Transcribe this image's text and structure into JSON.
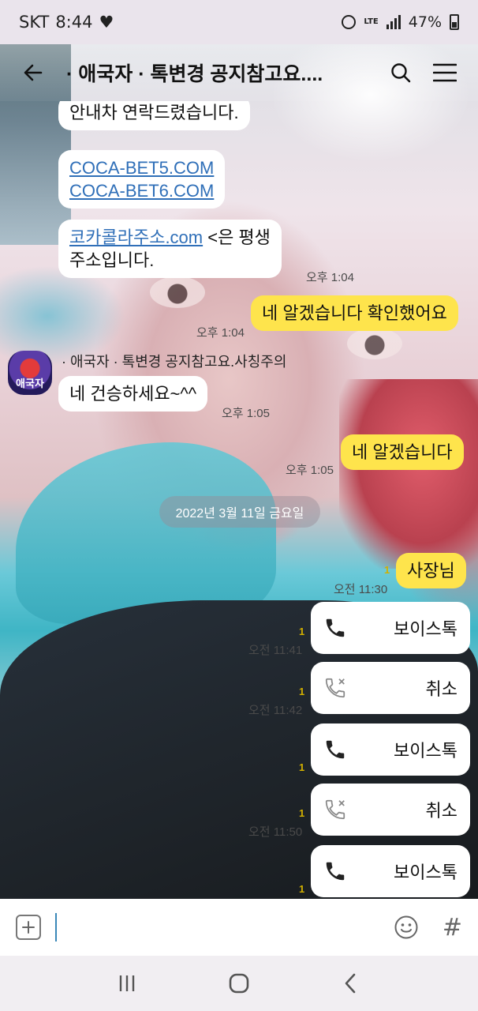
{
  "status_bar": {
    "carrier": "SKT",
    "time": "8:44",
    "heart": "♥",
    "lte": "LTE",
    "battery": "47%"
  },
  "header": {
    "title": "· 애국자 ·  톡변경 공지참고요...."
  },
  "messages": {
    "m1": "안내차 연락드렸습니다.",
    "m2_link1": "COCA-BET5.COM",
    "m2_link2": "COCA-BET6.COM",
    "m3_link": "코카콜라주소.com",
    "m3_rest": " <은 평생",
    "m3_line2": "주소입니다.",
    "t1": "오후 1:04",
    "m4": "네 알겠습니다 확인했어요",
    "t2": "오후 1:04",
    "sender": "· 애국자 ·  톡변경 공지참고요.사칭주의",
    "avatar_text": "애국자",
    "m5": "네 건승하세요~^^",
    "t3": "오후 1:05",
    "m6": "네 알겠습니다",
    "t4": "오후 1:05",
    "date": "2022년 3월 11일 금요일",
    "m7": "사장님",
    "read1": "1",
    "t5": "오전 11:30",
    "call1": "보이스톡",
    "read2": "1",
    "t6": "오전 11:41",
    "call2": "취소",
    "read3": "1",
    "t7": "오전 11:42",
    "call3": "보이스톡",
    "read4": "1",
    "call4": "취소",
    "read5": "1",
    "t8": "오전 11:50",
    "call5": "보이스톡",
    "read6": "1"
  },
  "input": {
    "hash": "#"
  },
  "colors": {
    "my_bubble": "#fee44c",
    "their_bubble": "#ffffff",
    "link": "#2f6fb8"
  }
}
